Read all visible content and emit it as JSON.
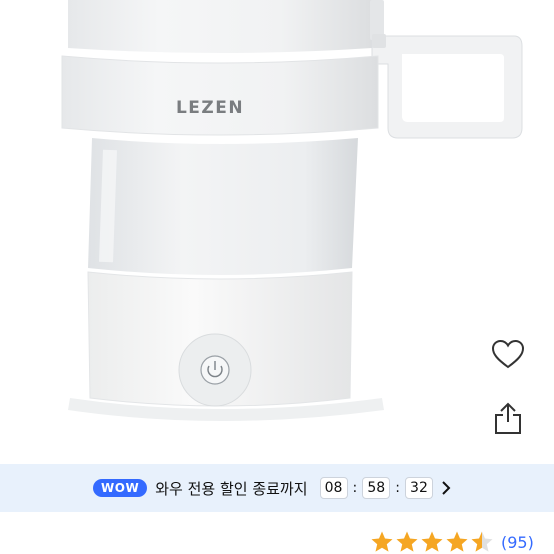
{
  "product": {
    "brand_logo_text": "LEZEN",
    "image_alt": "LEZEN foldable electric kettle"
  },
  "actions": {
    "wishlist_icon": "heart-outline-icon",
    "share_icon": "share-upload-icon"
  },
  "promo": {
    "badge": "WOW",
    "text": "와우 전용 할인 종료까지",
    "timer": {
      "hours": "08",
      "minutes": "58",
      "seconds": "32"
    },
    "separator": ":",
    "chevron_icon": "chevron-right-icon"
  },
  "rating": {
    "stars": 4.5,
    "max_stars": 5,
    "count_text": "(95)",
    "star_color": "#f5a623"
  },
  "colors": {
    "accent": "#346aff",
    "promo_background": "#e8f1fc"
  }
}
